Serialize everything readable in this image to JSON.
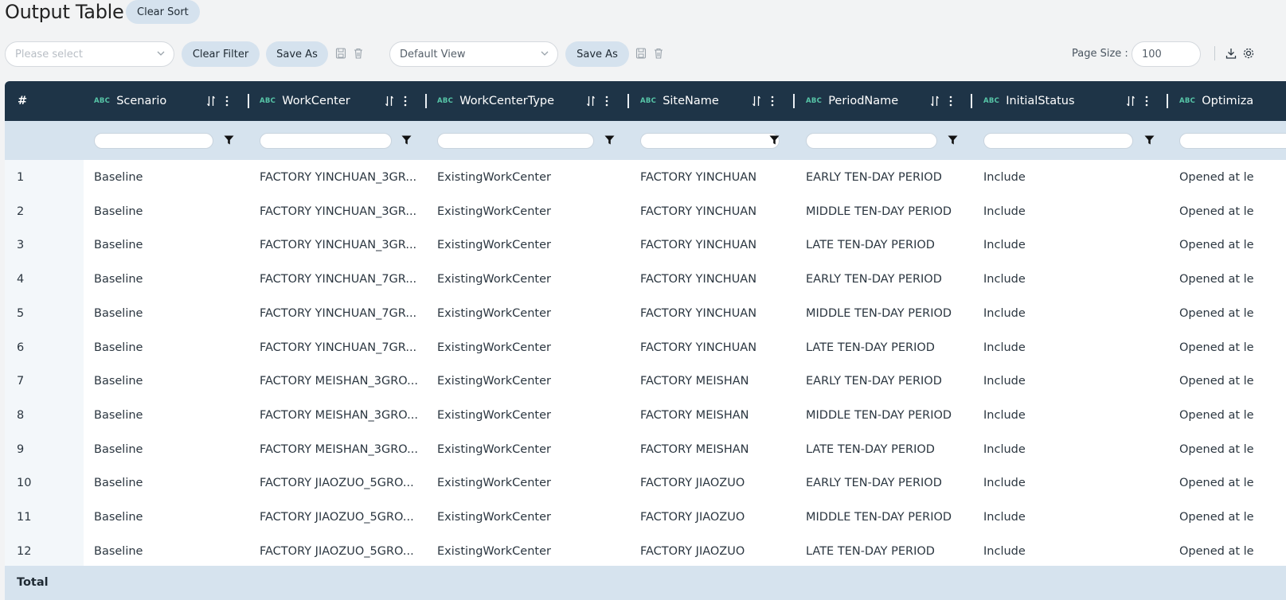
{
  "page": {
    "title": "Output Table",
    "clear_sort_label": "Clear Sort"
  },
  "toolbar": {
    "filter_select_placeholder": "Please select",
    "clear_filter_label": "Clear Filter",
    "save_as_filter_label": "Save As",
    "view_select_value": "Default View",
    "save_as_view_label": "Save As",
    "page_size_label": "Page Size :",
    "page_size_value": "100"
  },
  "table": {
    "index_header": "#",
    "type_badge": "ABC",
    "columns": [
      {
        "key": "scenario",
        "label": "Scenario"
      },
      {
        "key": "workcenter",
        "label": "WorkCenter"
      },
      {
        "key": "workcenter_type",
        "label": "WorkCenterType"
      },
      {
        "key": "site_name",
        "label": "SiteName"
      },
      {
        "key": "period_name",
        "label": "PeriodName"
      },
      {
        "key": "initial_status",
        "label": "InitialStatus"
      },
      {
        "key": "optimization",
        "label": "Optimiza"
      }
    ],
    "rows": [
      {
        "index": "1",
        "cells": [
          "Baseline",
          "FACTORY YINCHUAN_3GR...",
          "ExistingWorkCenter",
          "FACTORY YINCHUAN",
          "EARLY TEN-DAY PERIOD",
          "Include",
          "Opened at le"
        ]
      },
      {
        "index": "2",
        "cells": [
          "Baseline",
          "FACTORY YINCHUAN_3GR...",
          "ExistingWorkCenter",
          "FACTORY YINCHUAN",
          "MIDDLE TEN-DAY PERIOD",
          "Include",
          "Opened at le"
        ]
      },
      {
        "index": "3",
        "cells": [
          "Baseline",
          "FACTORY YINCHUAN_3GR...",
          "ExistingWorkCenter",
          "FACTORY YINCHUAN",
          "LATE TEN-DAY PERIOD",
          "Include",
          "Opened at le"
        ]
      },
      {
        "index": "4",
        "cells": [
          "Baseline",
          "FACTORY YINCHUAN_7GR...",
          "ExistingWorkCenter",
          "FACTORY YINCHUAN",
          "EARLY TEN-DAY PERIOD",
          "Include",
          "Opened at le"
        ]
      },
      {
        "index": "5",
        "cells": [
          "Baseline",
          "FACTORY YINCHUAN_7GR...",
          "ExistingWorkCenter",
          "FACTORY YINCHUAN",
          "MIDDLE TEN-DAY PERIOD",
          "Include",
          "Opened at le"
        ]
      },
      {
        "index": "6",
        "cells": [
          "Baseline",
          "FACTORY YINCHUAN_7GR...",
          "ExistingWorkCenter",
          "FACTORY YINCHUAN",
          "LATE TEN-DAY PERIOD",
          "Include",
          "Opened at le"
        ]
      },
      {
        "index": "7",
        "cells": [
          "Baseline",
          "FACTORY MEISHAN_3GRO...",
          "ExistingWorkCenter",
          "FACTORY MEISHAN",
          "EARLY TEN-DAY PERIOD",
          "Include",
          "Opened at le"
        ]
      },
      {
        "index": "8",
        "cells": [
          "Baseline",
          "FACTORY MEISHAN_3GRO...",
          "ExistingWorkCenter",
          "FACTORY MEISHAN",
          "MIDDLE TEN-DAY PERIOD",
          "Include",
          "Opened at le"
        ]
      },
      {
        "index": "9",
        "cells": [
          "Baseline",
          "FACTORY MEISHAN_3GRO...",
          "ExistingWorkCenter",
          "FACTORY MEISHAN",
          "LATE TEN-DAY PERIOD",
          "Include",
          "Opened at le"
        ]
      },
      {
        "index": "10",
        "cells": [
          "Baseline",
          "FACTORY JIAOZUO_5GRO...",
          "ExistingWorkCenter",
          "FACTORY JIAOZUO",
          "EARLY TEN-DAY PERIOD",
          "Include",
          "Opened at le"
        ]
      },
      {
        "index": "11",
        "cells": [
          "Baseline",
          "FACTORY JIAOZUO_5GRO...",
          "ExistingWorkCenter",
          "FACTORY JIAOZUO",
          "MIDDLE TEN-DAY PERIOD",
          "Include",
          "Opened at le"
        ]
      },
      {
        "index": "12",
        "cells": [
          "Baseline",
          "FACTORY JIAOZUO_5GRO...",
          "ExistingWorkCenter",
          "FACTORY JIAOZUO",
          "LATE TEN-DAY PERIOD",
          "Include",
          "Opened at le"
        ]
      }
    ],
    "total_label": "Total"
  },
  "colors": {
    "header_bg": "#1e3447",
    "filter_row_bg": "#d6e3ee",
    "pill_bg": "#d5e2ee",
    "type_badge": "#57c6a8"
  },
  "icons": [
    "chevron-down-icon",
    "save-icon",
    "trash-icon",
    "download-icon",
    "settings-icon",
    "sort-icon",
    "more-vertical-icon",
    "filter-icon"
  ]
}
